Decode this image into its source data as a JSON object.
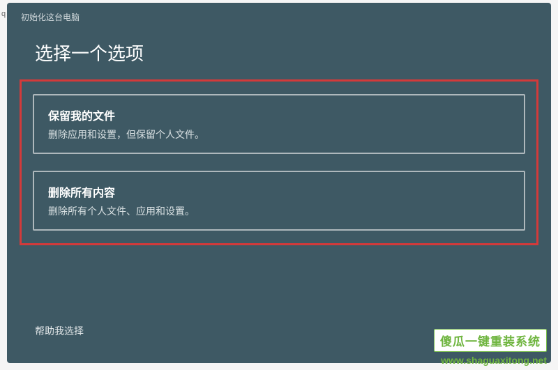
{
  "bgChar": "q",
  "dialog": {
    "title": "初始化这台电脑",
    "heading": "选择一个选项",
    "options": [
      {
        "title": "保留我的文件",
        "description": "删除应用和设置，但保留个人文件。"
      },
      {
        "title": "删除所有内容",
        "description": "删除所有个人文件、应用和设置。"
      }
    ],
    "helpLink": "帮助我选择"
  },
  "watermark": {
    "text": "傻瓜一键重装系统",
    "url": "www.shaguaxitong.net"
  }
}
